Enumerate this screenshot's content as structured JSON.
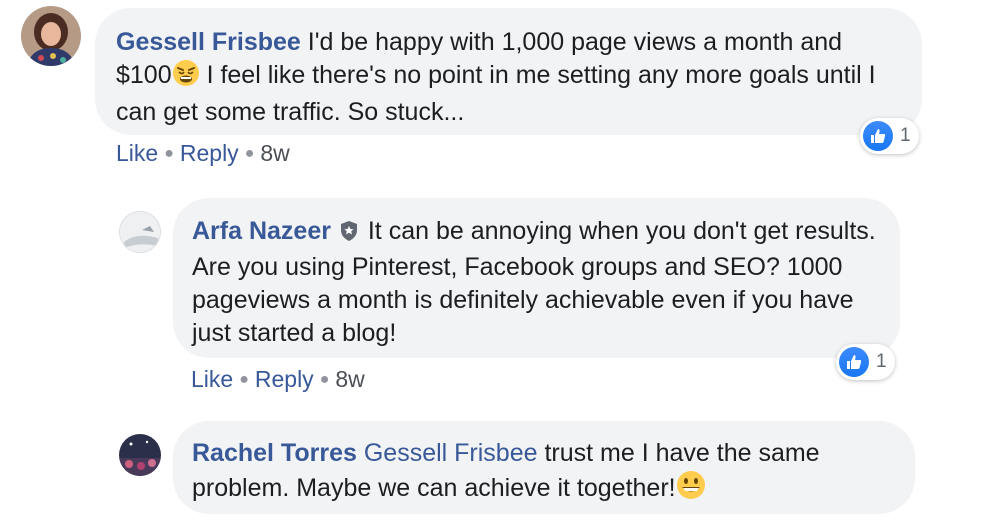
{
  "comments": [
    {
      "author": "Gessell Frisbee",
      "text_part1": "I'd be happy with 1,000 page views a month and $100",
      "emoji": "weary-face-emoji",
      "text_part2": " I feel like there's no point in me setting any more goals until I can get some traffic. So stuck...",
      "like_label": "Like",
      "reply_label": "Reply",
      "time": "8w",
      "reaction_count": "1"
    },
    {
      "author": "Arfa Nazeer",
      "badge": "shield-icon",
      "text": "It can be annoying when you don't get results. Are you using Pinterest, Facebook groups and SEO? 1000 pageviews a month is definitely achievable even if you have just started a blog!",
      "like_label": "Like",
      "reply_label": "Reply",
      "time": "8w",
      "reaction_count": "1"
    },
    {
      "author": "Rachel Torres",
      "mention": "Gessell Frisbee",
      "text": "trust me I have the same problem. Maybe we can achieve it together!",
      "emoji": "grinning-face-emoji"
    }
  ],
  "colors": {
    "link": "#385898",
    "bubble": "#f2f3f5",
    "like_blue": "#1877f2"
  }
}
